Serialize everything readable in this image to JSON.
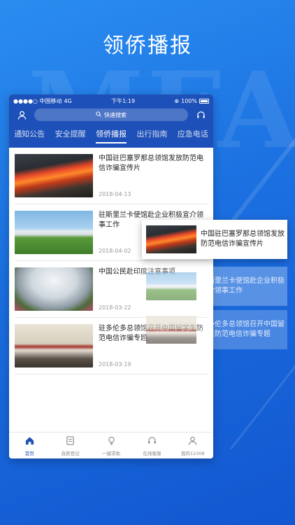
{
  "promo": {
    "headline": "领侨播报",
    "watermark": "MFA"
  },
  "status_bar": {
    "carrier": "●●●●○ 中国移动",
    "network": "4G",
    "time": "下午1:19",
    "battery": "100%"
  },
  "header": {
    "search_placeholder": "快速搜索",
    "profile_icon": "user-icon",
    "support_icon": "headset-icon"
  },
  "tabs": [
    {
      "label": "通知公告",
      "active": false
    },
    {
      "label": "安全提醒",
      "active": false
    },
    {
      "label": "领侨播报",
      "active": true
    },
    {
      "label": "出行指南",
      "active": false
    },
    {
      "label": "应急电话",
      "active": false
    }
  ],
  "news": [
    {
      "title": "中国驻巴塞罗那总领馆发放防范电信诈骗宣传片",
      "date": "2018-04-13",
      "thumb": "lava"
    },
    {
      "title": "驻斯里兰卡使馆赴企业积极宣介领事工作",
      "date": "2018-04-02",
      "thumb": "arch"
    },
    {
      "title": "中国公民赴印度注意事项",
      "date": "2018-03-22",
      "thumb": "crowd"
    },
    {
      "title": "驻多伦多总领馆召开中国留学生防范电信诈骗专题",
      "date": "2018-03-19",
      "thumb": "meet"
    }
  ],
  "bottom_nav": [
    {
      "label": "首页",
      "icon": "home-icon",
      "active": true
    },
    {
      "label": "自愿登记",
      "icon": "register-icon",
      "active": false
    },
    {
      "label": "一键求助",
      "icon": "lightbulb-icon",
      "active": false
    },
    {
      "label": "在线客服",
      "icon": "headset-icon",
      "active": false
    },
    {
      "label": "我的12308",
      "icon": "user-icon",
      "active": false
    }
  ],
  "floating_cards": [
    {
      "title": "中国驻巴塞罗那总领馆发放防范电信诈骗宣传片"
    },
    {
      "title": "驻斯里兰卡使馆赴企业积极宣介领事工作"
    },
    {
      "title": "驻多伦多总领馆召开中国留学生防范电信诈骗专题"
    }
  ],
  "colors": {
    "brand_blue": "#1d50b8",
    "background_blue": "#1b6fe0"
  }
}
